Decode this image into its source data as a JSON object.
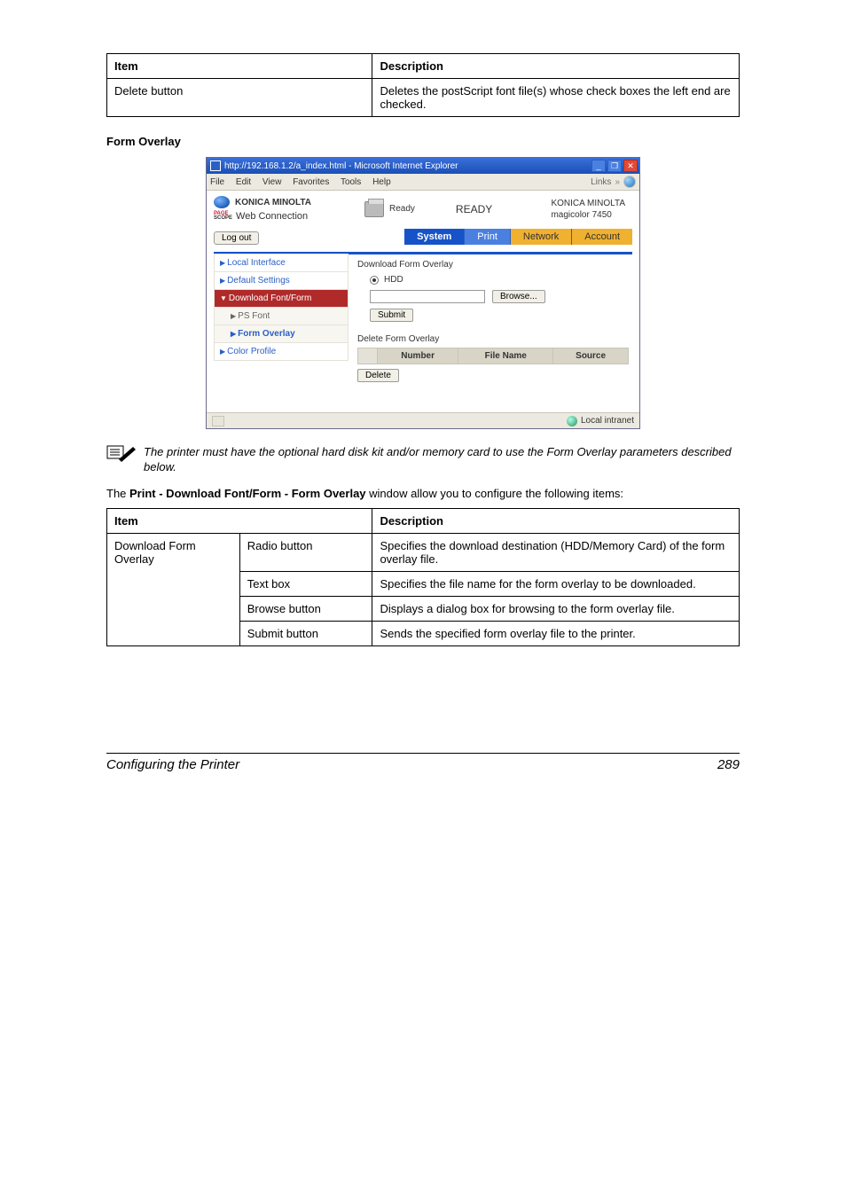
{
  "table1": {
    "head_item": "Item",
    "head_desc": "Description",
    "row_item": "Delete button",
    "row_desc": "Deletes the postScript font file(s) whose check boxes the left end are checked."
  },
  "section_heading": "Form Overlay",
  "ie": {
    "title": "http://192.168.1.2/a_index.html - Microsoft Internet Explorer",
    "menus": {
      "file": "File",
      "edit": "Edit",
      "view": "View",
      "fav": "Favorites",
      "tools": "Tools",
      "help": "Help"
    },
    "links_label": "Links",
    "links_chevron": "»",
    "logo_text": "KONICA MINOLTA",
    "pagescope_1": "PAGE",
    "pagescope_2": "SCOPE",
    "webconn": "Web Connection",
    "ready_small": "Ready",
    "ready_big": "READY",
    "model_line1": "KONICA MINOLTA",
    "model_line2": "magicolor 7450",
    "logout": "Log out",
    "tabs": {
      "system": "System",
      "print": "Print",
      "network": "Network",
      "account": "Account"
    },
    "side": {
      "local": "Local Interface",
      "default": "Default Settings",
      "dlff": "Download Font/Form",
      "psfont": "PS Font",
      "formoverlay": "Form Overlay",
      "color": "Color Profile"
    },
    "main": {
      "dl_title": "Download Form Overlay",
      "hdd": "HDD",
      "browse": "Browse...",
      "submit": "Submit",
      "del_title": "Delete Form Overlay",
      "col_number": "Number",
      "col_file": "File Name",
      "col_source": "Source",
      "delete": "Delete"
    },
    "status_text": "Local intranet"
  },
  "note_text": "The printer must have the optional hard disk kit and/or memory card to use the Form Overlay parameters described below.",
  "para": {
    "pre": "The ",
    "bold": "Print - Download Font/Form - Form Overlay",
    "post": " window allow you to configure the following items:"
  },
  "table2": {
    "head_item": "Item",
    "head_desc": "Description",
    "group": "Download Form Overlay",
    "r1_sub": "Radio button",
    "r1_desc": "Specifies the download destination (HDD/Memory Card) of the form overlay file.",
    "r2_sub": "Text box",
    "r2_desc": "Specifies the file name for the form overlay to be downloaded.",
    "r3_sub": "Browse button",
    "r3_desc": "Displays a dialog box for browsing to the form overlay file.",
    "r4_sub": "Submit button",
    "r4_desc": "Sends the specified form overlay file to the printer."
  },
  "footer": {
    "title": "Configuring the Printer",
    "page": "289"
  }
}
